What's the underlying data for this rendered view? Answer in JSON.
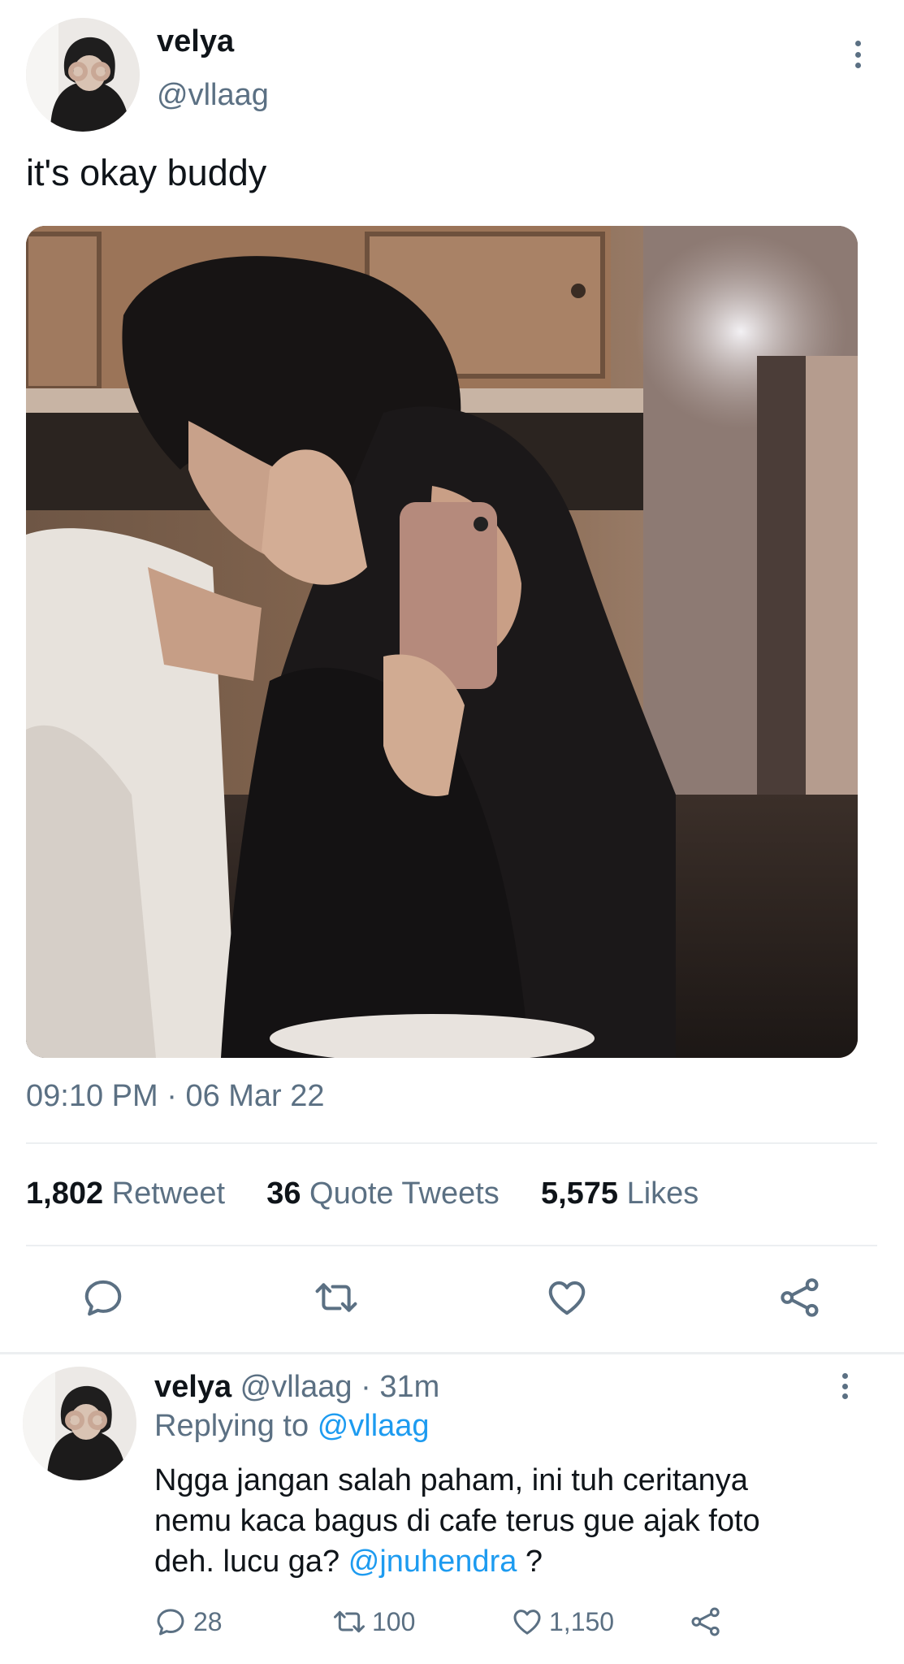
{
  "tweet": {
    "author_name": "velya",
    "author_handle": "@vllaag",
    "text": "it's okay buddy",
    "timestamp": "09:10 PM",
    "date": "06 Mar 22",
    "date_separator": "·",
    "stats": {
      "retweets_count": "1,802",
      "retweets_label": "Retweet",
      "quotes_count": "36",
      "quotes_label": "Quote Tweets",
      "likes_count": "5,575",
      "likes_label": "Likes"
    },
    "actions": [
      "reply-icon",
      "retweet-icon",
      "like-icon",
      "share-icon"
    ]
  },
  "reply": {
    "author_name": "velya",
    "author_handle": "@vllaag",
    "separator": "·",
    "time": "31m",
    "replying_to_label": "Replying to",
    "replying_to_handle": "@vllaag",
    "text_line1": "Ngga jangan salah paham, ini tuh ceritanya",
    "text_line2": "nemu kaca bagus di cafe terus gue ajak foto",
    "text_line3_prefix": "deh. lucu ga?",
    "mention": "@jnuhendra",
    "text_line3_suffix": "?",
    "reply_count": "28",
    "retweet_count": "100",
    "like_count": "1,150"
  },
  "colors": {
    "text": "#0f1419",
    "secondary": "#5b7083",
    "link": "#1d9bf0",
    "divider": "#eceff1"
  }
}
